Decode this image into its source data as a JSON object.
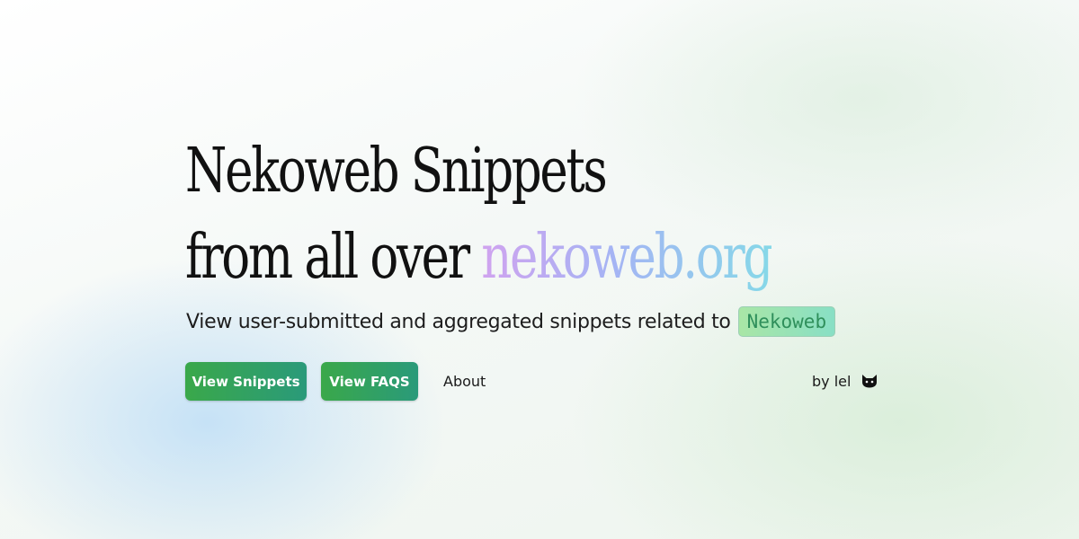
{
  "hero": {
    "headline_line1": "Nekoweb Snippets",
    "headline_line2_prefix": "from all over ",
    "headline_line2_highlight": "nekoweb.org",
    "subtitle": "View user-submitted and aggregated snippets related to",
    "subtitle_code": "Nekoweb"
  },
  "actions": {
    "view_snippets": "View Snippets",
    "view_faqs": "View FAQS",
    "about": "About",
    "byline": "by lel",
    "byline_icon": "cat-icon"
  },
  "colors": {
    "button_gradient_start": "#3aa84a",
    "button_gradient_end": "#2a9a7a",
    "highlight_gradient_start": "#d0a3ef",
    "highlight_gradient_end": "#86d8e8",
    "code_chip_text": "#2f8f5b"
  }
}
